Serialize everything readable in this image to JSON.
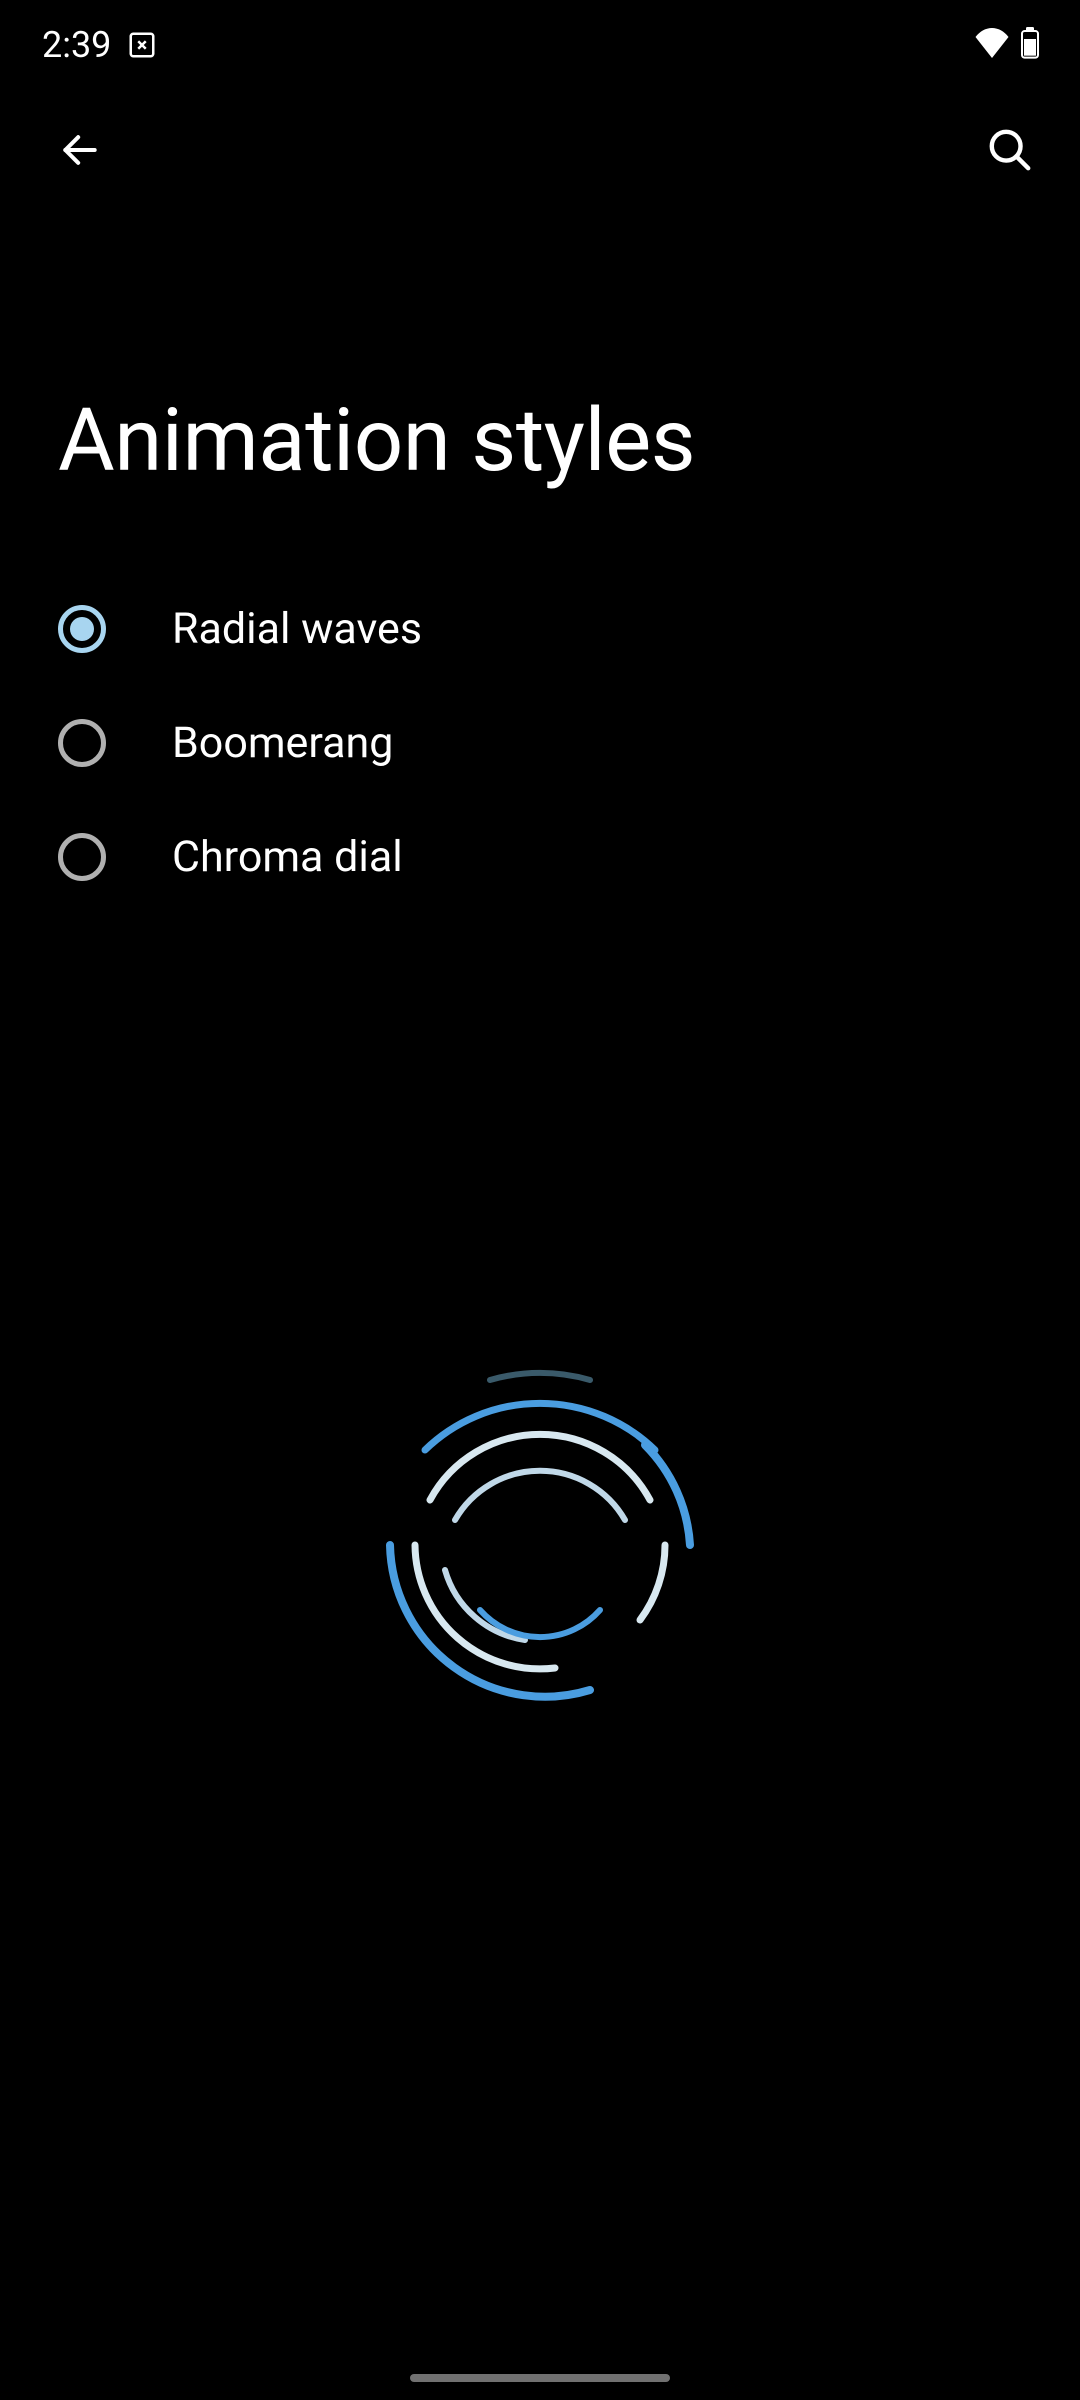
{
  "status_bar": {
    "time": "2:39",
    "icons": {
      "close_box": "close-box-icon",
      "wifi": "wifi-icon",
      "battery": "battery-icon"
    }
  },
  "app_bar": {
    "back": "back-icon",
    "search": "search-icon"
  },
  "page": {
    "title": "Animation styles"
  },
  "options": [
    {
      "label": "Radial waves",
      "selected": true
    },
    {
      "label": "Boomerang",
      "selected": false
    },
    {
      "label": "Chroma dial",
      "selected": false
    }
  ],
  "colors": {
    "accent": "#a8d5f0",
    "preview_blue": "#4a9de0",
    "preview_light": "#d8e8f0"
  }
}
